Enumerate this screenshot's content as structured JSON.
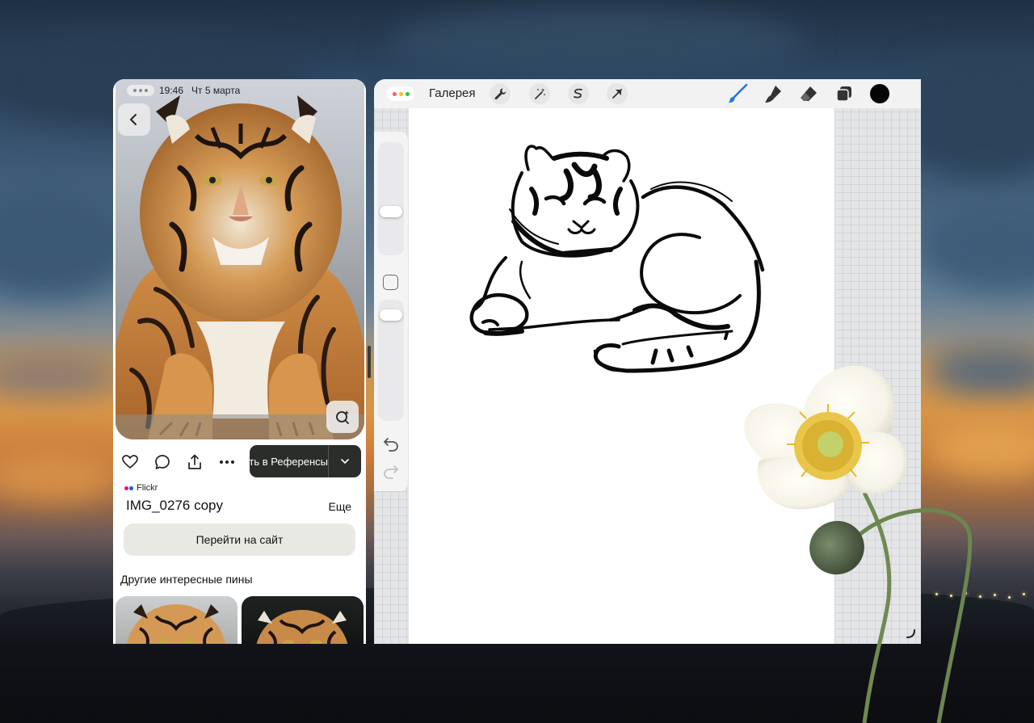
{
  "status_bar": {
    "time": "19:46",
    "date": "Чт 5 марта"
  },
  "pin": {
    "save_button_label": "Сохранить в Референсы",
    "source_name": "Flickr",
    "title": "IMG_0276 copy",
    "more_link": "Еще",
    "visit_button": "Перейти на сайт",
    "more_pins_heading": "Другие интересные пины"
  },
  "procreate": {
    "gallery_link": "Галерея",
    "brush_color": "#050505",
    "toolbar_icons": [
      "wrench-icon",
      "magic-wand-icon",
      "selection-icon",
      "transform-arrow-icon",
      "brush-icon",
      "smudge-icon",
      "eraser-icon",
      "layers-icon",
      "color-swatch"
    ],
    "sidebar_icons": [
      "brush-size-slider",
      "modify-button",
      "opacity-slider",
      "undo-icon",
      "redo-icon"
    ]
  },
  "colors": {
    "accent_blue": "#1f7ae0",
    "save_button_bg": "#2b2d2a",
    "traffic_red": "#ff5f57",
    "traffic_yellow": "#febc2e",
    "traffic_green": "#28c840",
    "flickr_pink": "#ff0084",
    "flickr_blue": "#0063dc"
  }
}
